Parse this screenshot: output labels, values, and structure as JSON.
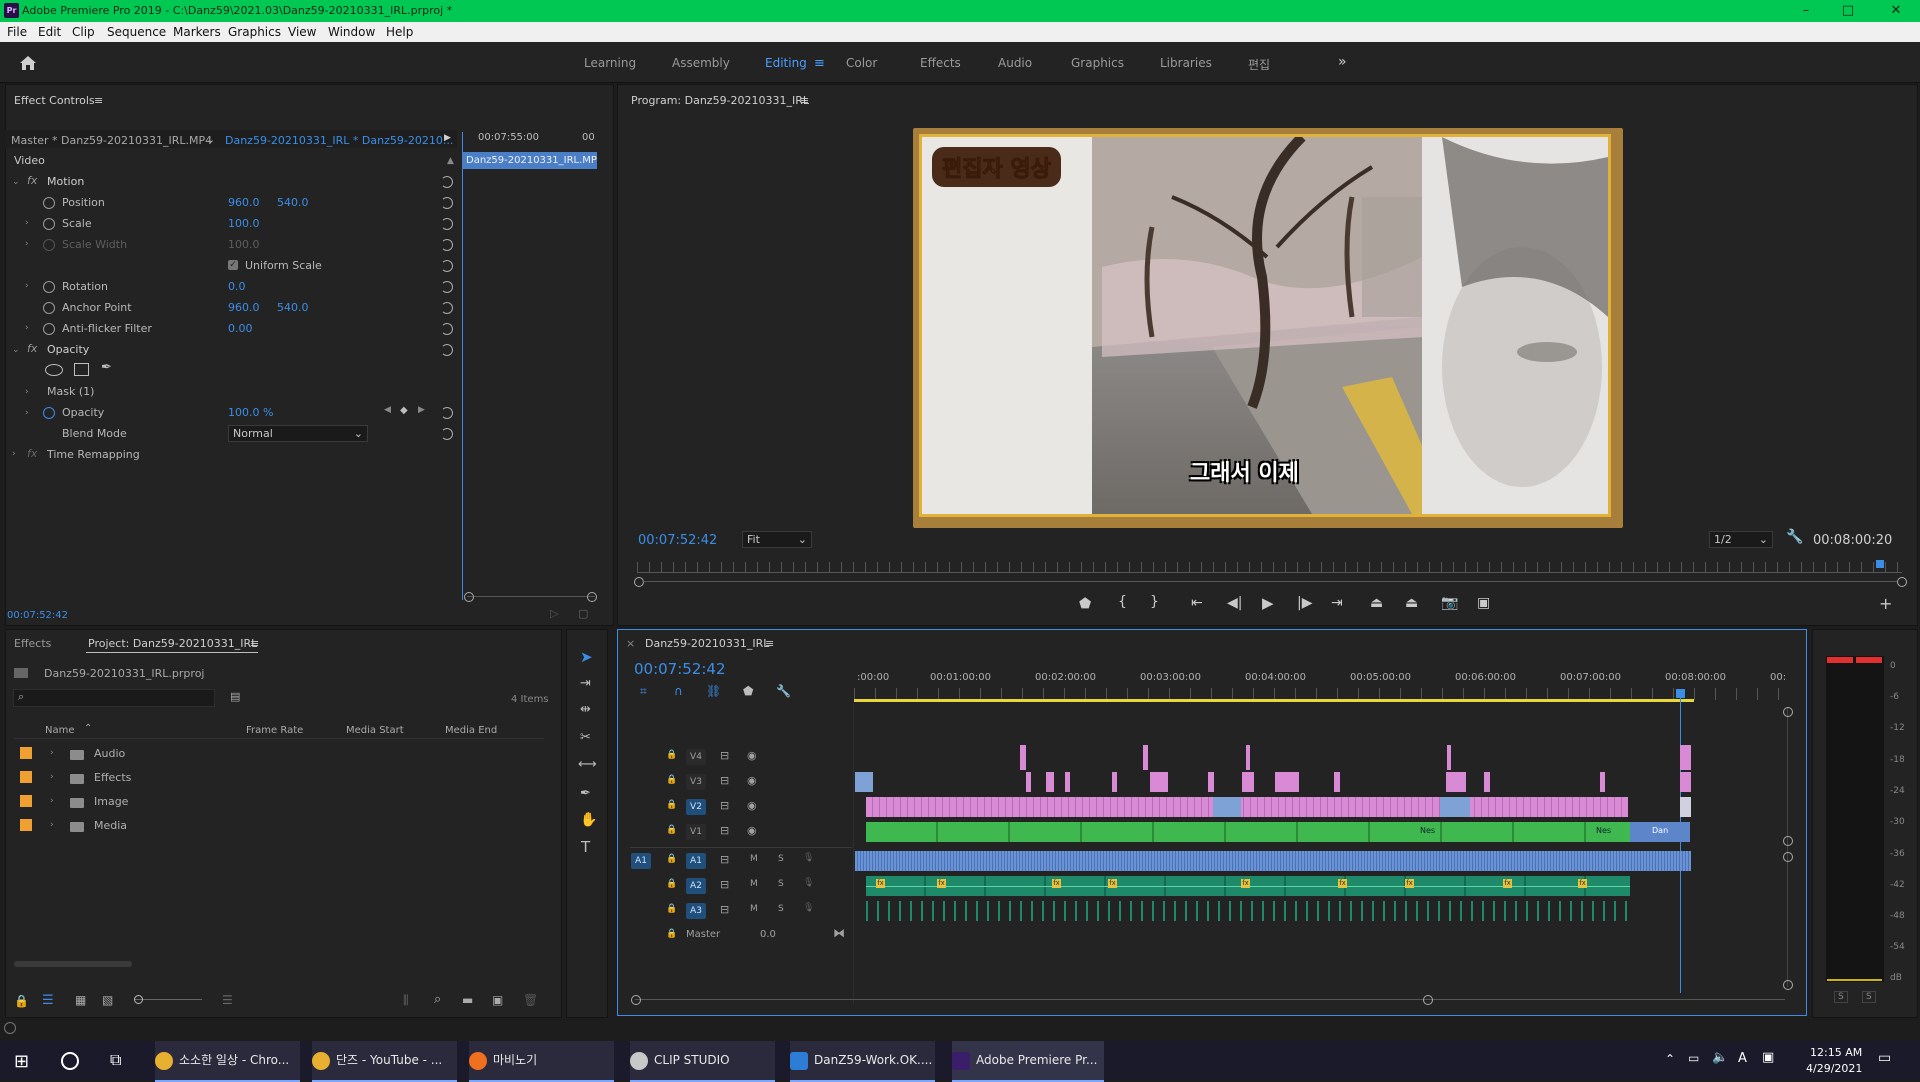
{
  "titlebar": {
    "logo": "Pr",
    "title": "Adobe Premiere Pro 2019 - C:\\Danz59\\2021.03\\Danz59-20210331_IRL.prproj *",
    "min": "–",
    "max": "□",
    "close": "✕"
  },
  "menu": [
    "File",
    "Edit",
    "Clip",
    "Sequence",
    "Markers",
    "Graphics",
    "View",
    "Window",
    "Help"
  ],
  "workspaces": {
    "items": [
      "Learning",
      "Assembly",
      "Editing",
      "Color",
      "Effects",
      "Audio",
      "Graphics",
      "Libraries",
      "편집"
    ],
    "active": "Editing",
    "more": "»"
  },
  "effect_controls": {
    "tab": "Effect Controls",
    "master": "Master * Danz59-20210331_IRL.MP4",
    "seq": "Danz59-20210331_IRL * Danz59-20210...",
    "time_head": "00:07:55:00",
    "time_head2": "00",
    "clip_label": "Danz59-20210331_IRL.MP",
    "video": "Video",
    "motion": "Motion",
    "position": {
      "label": "Position",
      "x": "960.0",
      "y": "540.0"
    },
    "scale": {
      "label": "Scale",
      "v": "100.0"
    },
    "scale_width": {
      "label": "Scale Width",
      "v": "100.0"
    },
    "uniform": "Uniform Scale",
    "rotation": {
      "label": "Rotation",
      "v": "0.0"
    },
    "anchor": {
      "label": "Anchor Point",
      "x": "960.0",
      "y": "540.0"
    },
    "antiflicker": {
      "label": "Anti-flicker Filter",
      "v": "0.00"
    },
    "opacity_section": "Opacity",
    "mask": "Mask (1)",
    "opacity": {
      "label": "Opacity",
      "v": "100.0 %"
    },
    "blend": {
      "label": "Blend Mode",
      "v": "Normal"
    },
    "time_remap": "Time Remapping",
    "timecode": "00:07:52:42"
  },
  "program": {
    "tab": "Program: Danz59-20210331_IRL",
    "timecode": "00:07:52:42",
    "fit": "Fit",
    "res": "1/2",
    "duration": "00:08:00:20",
    "overlay_title": "편집자 영상",
    "subtitle": "그래서 이제"
  },
  "project": {
    "tab_effects": "Effects",
    "tab_project": "Project: Danz59-20210331_IRL",
    "file": "Danz59-20210331_IRL.prproj",
    "count": "4 Items",
    "columns": [
      "Name",
      "Frame Rate",
      "Media Start",
      "Media End"
    ],
    "items": [
      "Audio",
      "Effects",
      "Image",
      "Media"
    ],
    "colors": [
      "#f0a030",
      "#f0a030",
      "#f0a030",
      "#f0a030"
    ]
  },
  "timeline": {
    "tab": "Danz59-20210331_IRL",
    "timecode": "00:07:52:42",
    "ruler": [
      ":00:00",
      "00:01:00:00",
      "00:02:00:00",
      "00:03:00:00",
      "00:04:00:00",
      "00:05:00:00",
      "00:06:00:00",
      "00:07:00:00",
      "00:08:00:00",
      "00:"
    ],
    "video_tracks": [
      "V4",
      "V3",
      "V2",
      "V1"
    ],
    "audio_tracks": [
      "A1",
      "A2",
      "A3"
    ],
    "source_patch": "A1",
    "master": {
      "label": "Master",
      "v": "0.0"
    },
    "m": "M",
    "s": "S",
    "clip_labels": [
      "Nes",
      "Nes",
      "Dan"
    ]
  },
  "meter": {
    "scale": [
      "0",
      "-6",
      "-12",
      "-18",
      "-24",
      "-30",
      "-36",
      "-42",
      "-48",
      "-54",
      "dB"
    ],
    "solo": [
      "S",
      "S"
    ]
  },
  "taskbar": {
    "items": [
      {
        "label": "소소한 일상 - Chro...",
        "color": "#e8b030"
      },
      {
        "label": "단즈 - YouTube - ...",
        "color": "#e8b030"
      },
      {
        "label": "마비노기",
        "color": "#f07020"
      },
      {
        "label": "CLIP STUDIO",
        "color": "#c8c8c8"
      },
      {
        "label": "DanZ59-Work.OK....",
        "color": "#2d7cd6"
      },
      {
        "label": "Adobe Premiere Pr...",
        "color": "#3a1e6a"
      }
    ],
    "time": "12:15 AM",
    "date": "4/29/2021",
    "lang": "A"
  }
}
